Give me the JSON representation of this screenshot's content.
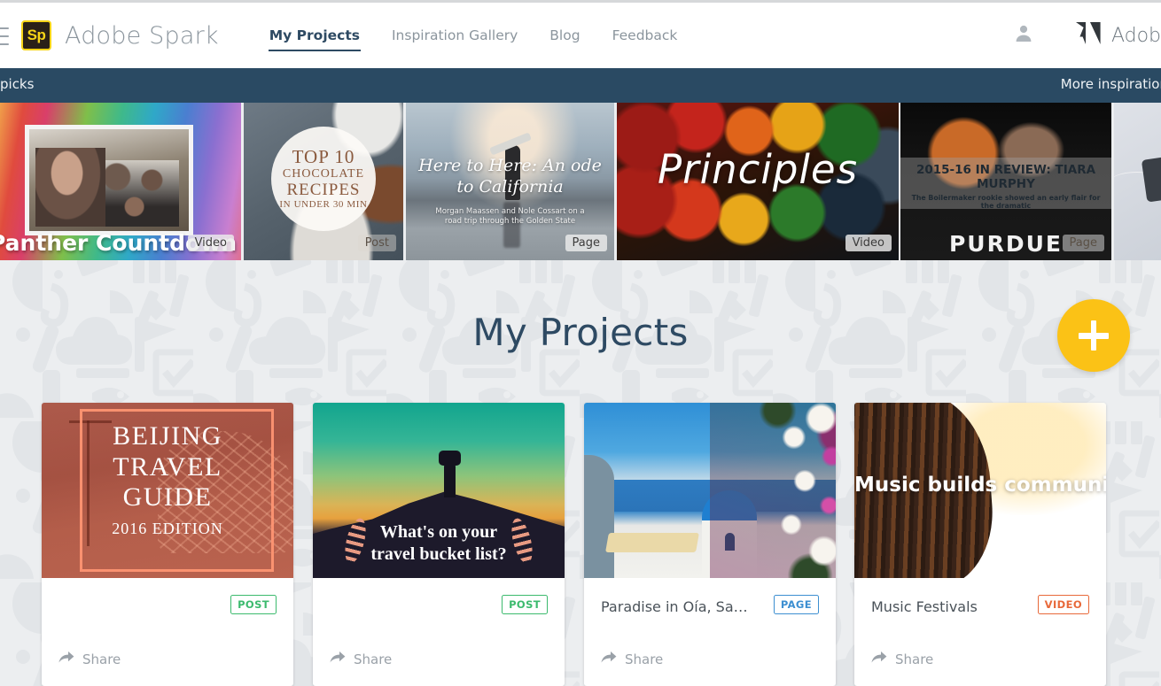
{
  "header": {
    "menu_icon": "hamburger-icon",
    "logo_text": "Sp",
    "brand_name": "Adobe Spark",
    "nav": [
      {
        "label": "My Projects",
        "active": true
      },
      {
        "label": "Inspiration Gallery",
        "active": false
      },
      {
        "label": "Blog",
        "active": false
      },
      {
        "label": "Feedback",
        "active": false
      }
    ],
    "account_icon": "user-avatar-icon",
    "adobe_logo_icon": "adobe-logo-icon",
    "adobe_label": "Adob"
  },
  "inspiration_bar": {
    "left_label": "picks",
    "right_label": "More inspiration",
    "background": "#2a4a63"
  },
  "carousel": [
    {
      "title": "Panther Countdown",
      "badge": "Video"
    },
    {
      "title_l1": "TOP 10",
      "title_l2": "CHOCOLATE",
      "title_l3": "RECIPES",
      "title_l4": "IN UNDER 30 MIN",
      "badge": "Post"
    },
    {
      "title": "Here to Here: An ode to California",
      "subtitle": "Morgan Maassen and Nole Cossart on a road trip through the Golden State",
      "badge": "Page"
    },
    {
      "title": "Principles",
      "badge": "Video"
    },
    {
      "title": "2015-16 IN REVIEW: TIARA MURPHY",
      "subtitle": "The Boilermaker rookie showed an early flair for the dramatic",
      "overlay_word": "PURDUE",
      "badge": "Page"
    }
  ],
  "main": {
    "section_title": "My Projects",
    "create_button_icon": "plus-icon",
    "create_button_color": "#fbc216",
    "background_color": "#eceef0"
  },
  "projects": [
    {
      "title": "",
      "cover_l1": "BEIJING",
      "cover_l2": "TRAVEL",
      "cover_l3": "GUIDE",
      "cover_l4": "2016 EDITION",
      "type": "POST",
      "type_color": "#3cba6e",
      "share_label": "Share",
      "share_icon": "share-arrow-icon"
    },
    {
      "title": "",
      "cover_l1": "What's on your",
      "cover_l2": "travel bucket list?",
      "type": "POST",
      "type_color": "#3cba6e",
      "share_label": "Share",
      "share_icon": "share-arrow-icon"
    },
    {
      "title": "Paradise in Oía, Santorini",
      "type": "PAGE",
      "type_color": "#3d8fd1",
      "share_label": "Share",
      "share_icon": "share-arrow-icon"
    },
    {
      "title": "Music Festivals",
      "cover_l1": "Music builds community",
      "type": "VIDEO",
      "type_color": "#e8693a",
      "share_label": "Share",
      "share_icon": "share-arrow-icon"
    }
  ]
}
